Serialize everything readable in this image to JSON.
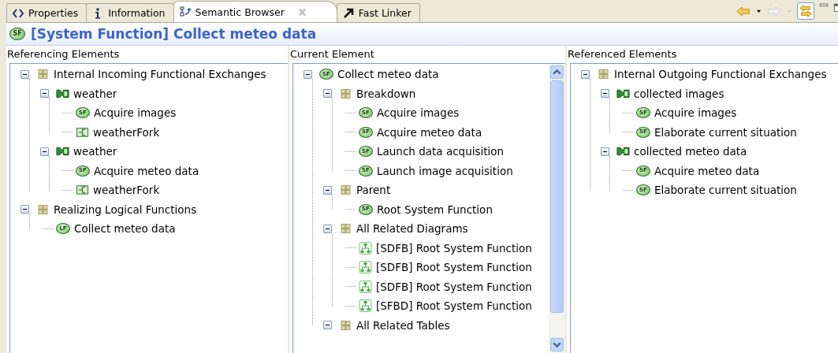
{
  "tabs": [
    {
      "label": "Properties",
      "kind": "properties",
      "selected": false,
      "closable": false
    },
    {
      "label": "Information",
      "kind": "information",
      "selected": false,
      "closable": false
    },
    {
      "label": "Semantic Browser",
      "kind": "browser",
      "selected": true,
      "closable": true
    },
    {
      "label": "Fast Linker",
      "kind": "linker",
      "selected": false,
      "closable": false
    }
  ],
  "toolbar": [
    {
      "kind": "back",
      "disabled": false
    },
    {
      "kind": "dropdown",
      "disabled": false
    },
    {
      "kind": "forward",
      "disabled": true
    },
    {
      "kind": "dropdown",
      "disabled": true
    },
    {
      "kind": "sync",
      "selected": true
    },
    {
      "kind": "minimize"
    },
    {
      "kind": "maximize"
    }
  ],
  "title": {
    "badge": "SF",
    "text": "[System Function] Collect meteo data"
  },
  "columns": [
    {
      "heading": "Referencing Elements",
      "scrollbar": false,
      "tree": [
        {
          "label": "Internal Incoming Functional Exchanges",
          "kind": "category",
          "expanded": true,
          "children": [
            {
              "label": "weather",
              "kind": "exchange",
              "expanded": true,
              "children": [
                {
                  "label": "Acquire images",
                  "kind": "function",
                  "badge": "SF"
                },
                {
                  "label": "weatherFork",
                  "kind": "fork"
                }
              ]
            },
            {
              "label": "weather",
              "kind": "exchange",
              "expanded": true,
              "children": [
                {
                  "label": "Acquire meteo data",
                  "kind": "function",
                  "badge": "SF"
                },
                {
                  "label": "weatherFork",
                  "kind": "fork"
                }
              ]
            }
          ]
        },
        {
          "label": "Realizing Logical Functions",
          "kind": "category",
          "expanded": true,
          "children": [
            {
              "label": "Collect meteo data",
              "kind": "function",
              "badge": "LF"
            }
          ]
        }
      ]
    },
    {
      "heading": "Current Element",
      "scrollbar": true,
      "tree": [
        {
          "label": "Collect meteo data",
          "kind": "function",
          "badge": "SF",
          "expanded": true,
          "children": [
            {
              "label": "Breakdown",
              "kind": "category",
              "expanded": true,
              "children": [
                {
                  "label": "Acquire images",
                  "kind": "function",
                  "badge": "SF"
                },
                {
                  "label": "Acquire meteo data",
                  "kind": "function",
                  "badge": "SF"
                },
                {
                  "label": "Launch data acquisition",
                  "kind": "function",
                  "badge": "SF"
                },
                {
                  "label": "Launch image acquisition",
                  "kind": "function",
                  "badge": "SF"
                }
              ]
            },
            {
              "label": "Parent",
              "kind": "category",
              "expanded": true,
              "children": [
                {
                  "label": "Root System Function",
                  "kind": "function",
                  "badge": "SF"
                }
              ]
            },
            {
              "label": "All Related Diagrams",
              "kind": "category",
              "expanded": true,
              "children": [
                {
                  "label": "[SDFB] Root System Function",
                  "kind": "diagram"
                },
                {
                  "label": "[SDFB] Root System Function",
                  "kind": "diagram"
                },
                {
                  "label": "[SDFB] Root System Function",
                  "kind": "diagram"
                },
                {
                  "label": "[SFBD] Root System Function",
                  "kind": "diagram"
                }
              ]
            },
            {
              "label": "All Related Tables",
              "kind": "category",
              "expanded": true
            }
          ]
        }
      ]
    },
    {
      "heading": "Referenced Elements",
      "scrollbar": false,
      "tree": [
        {
          "label": "Internal Outgoing Functional Exchanges",
          "kind": "category",
          "expanded": true,
          "children": [
            {
              "label": "collected images",
              "kind": "exchange",
              "expanded": true,
              "children": [
                {
                  "label": "Acquire images",
                  "kind": "function",
                  "badge": "SF"
                },
                {
                  "label": "Elaborate current situation",
                  "kind": "function",
                  "badge": "SF"
                }
              ]
            },
            {
              "label": "collected meteo data",
              "kind": "exchange",
              "expanded": true,
              "children": [
                {
                  "label": "Acquire meteo data",
                  "kind": "function",
                  "badge": "SF"
                },
                {
                  "label": "Elaborate current situation",
                  "kind": "function",
                  "badge": "SF"
                }
              ]
            }
          ]
        }
      ]
    }
  ]
}
